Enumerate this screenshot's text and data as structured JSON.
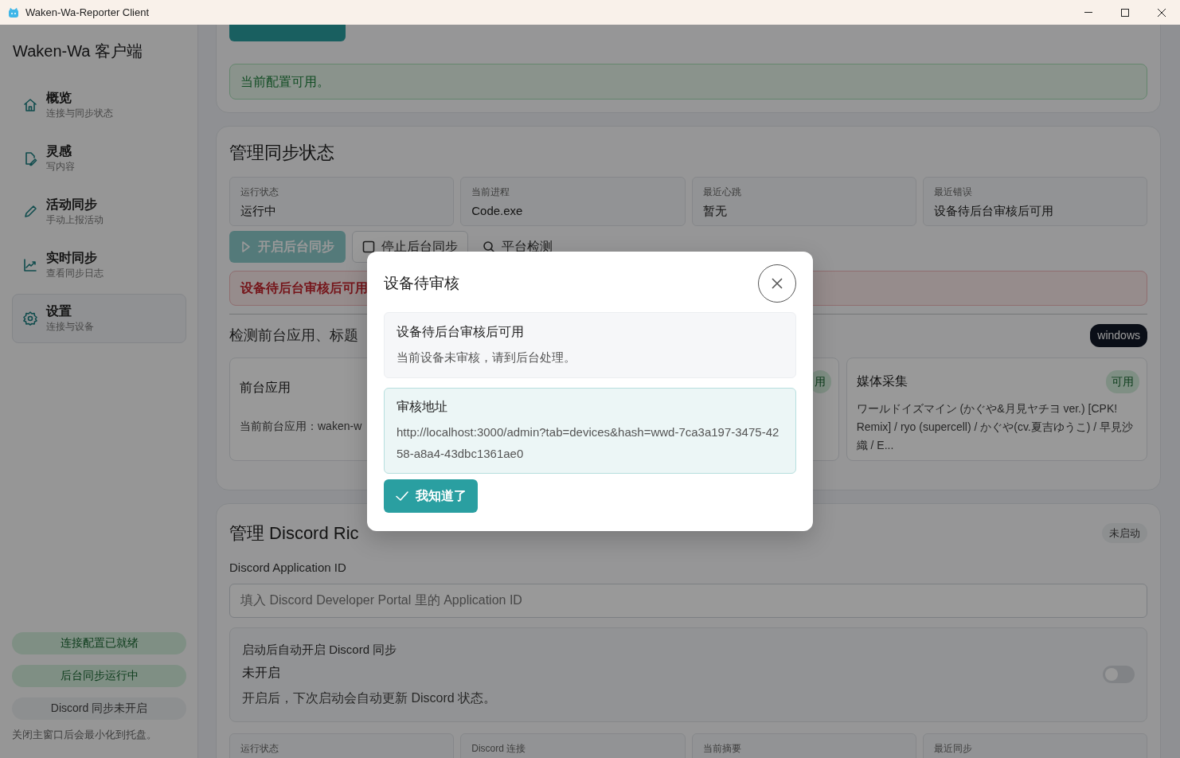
{
  "window": {
    "title": "Waken-Wa-Reporter Client"
  },
  "sidebar": {
    "app_title": "Waken-Wa 客户端",
    "items": [
      {
        "label": "概览",
        "sublabel": "连接与同步状态",
        "selected": false
      },
      {
        "label": "灵感",
        "sublabel": "写内容",
        "selected": false
      },
      {
        "label": "活动同步",
        "sublabel": "手动上报活动",
        "selected": false
      },
      {
        "label": "实时同步",
        "sublabel": "查看同步日志",
        "selected": false
      },
      {
        "label": "设置",
        "sublabel": "连接与设备",
        "selected": true
      }
    ],
    "status_pills": [
      {
        "text": "连接配置已就绪",
        "kind": "success"
      },
      {
        "text": "后台同步运行中",
        "kind": "success"
      },
      {
        "text": "Discord 同步未开启",
        "kind": "neutral"
      }
    ],
    "footnote": "关闭主窗口后会最小化到托盘。"
  },
  "config_card": {
    "alert": "当前配置可用。"
  },
  "sync_card": {
    "title": "管理同步状态",
    "stats": [
      {
        "label": "运行状态",
        "value": "运行中"
      },
      {
        "label": "当前进程",
        "value": "Code.exe"
      },
      {
        "label": "最近心跳",
        "value": "暂无"
      },
      {
        "label": "最近错误",
        "value": "设备待后台审核后可用"
      }
    ],
    "buttons": [
      {
        "label": "开启后台同步",
        "kind": "primary",
        "disabled": true
      },
      {
        "label": "停止后台同步",
        "kind": "outline",
        "disabled": false
      },
      {
        "label": "平台检测",
        "kind": "link",
        "disabled": false
      }
    ],
    "error_alert": "设备待后台审核后可用",
    "section_title": "检测前台应用、标题",
    "platform_badge": "windows",
    "capabilities": [
      {
        "title": "前台应用",
        "text": "当前前台应用：waken-w"
      },
      {
        "badge": "用"
      },
      {
        "title": "媒体采集",
        "badge": "可用",
        "text": "ワールドイズマイン (かぐや&月見ヤチヨ ver.) [CPK! Remix] / ryo (supercell) / かぐや(cv.夏吉ゆうこ) / 早見沙織 / E..."
      }
    ]
  },
  "discord_card": {
    "title": "管理 Discord Ric",
    "status_badge": "未启动",
    "app_id_label": "Discord Application ID",
    "app_id_placeholder": "填入 Discord Developer Portal 里的 Application ID",
    "autostart": {
      "label": "启动后自动开启 Discord 同步",
      "state_text": "未开启",
      "hint": "开启后，下次启动会自动更新 Discord 状态。",
      "on": false
    },
    "stats": [
      {
        "label": "运行状态"
      },
      {
        "label": "Discord 连接"
      },
      {
        "label": "当前摘要"
      },
      {
        "label": "最近同步"
      }
    ]
  },
  "dialog": {
    "title": "设备待审核",
    "notice": {
      "title": "设备待后台审核后可用",
      "text": "当前设备未审核，请到后台处理。"
    },
    "review": {
      "title": "审核地址",
      "url": "http://localhost:3000/admin?tab=devices&hash=wwd-7ca3a197-3475-4258-a8a4-43dbc1361ae0"
    },
    "confirm_button": "我知道了"
  }
}
